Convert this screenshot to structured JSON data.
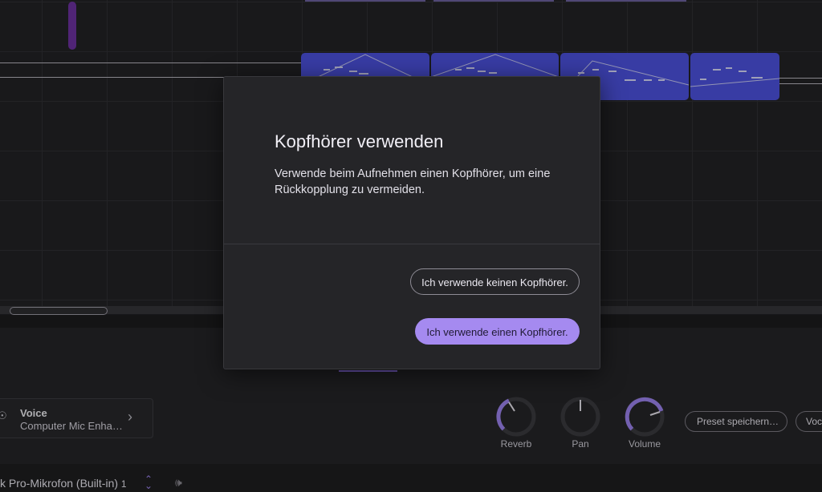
{
  "dialog": {
    "title": "Kopfhörer verwenden",
    "body": "Verwende beim Aufnehmen einen Kopfhörer, um eine Rückkopplung zu vermeiden.",
    "no_headphones_label": "Ich verwende keinen Kopfhörer.",
    "headphones_label": "Ich verwende einen Kopfhörer."
  },
  "preset": {
    "title": "Voice",
    "subtitle": "Computer Mic Enha…"
  },
  "knobs": {
    "reverb": "Reverb",
    "pan": "Pan",
    "volume": "Volume"
  },
  "buttons": {
    "save_preset": "Preset speichern…",
    "partial": "Voc"
  },
  "footer": {
    "mic_label": "k Pro-Mikrofon (Built-in)",
    "channel": "1"
  },
  "colors": {
    "accent": "#a58af0",
    "clip": "#4a4fe0",
    "background": "#1d1d20"
  },
  "icons": {
    "pin": "pin-icon",
    "chevron": "chevron-right-icon",
    "updown": "updown-chevron-icon",
    "input": "input-monitor-icon"
  }
}
